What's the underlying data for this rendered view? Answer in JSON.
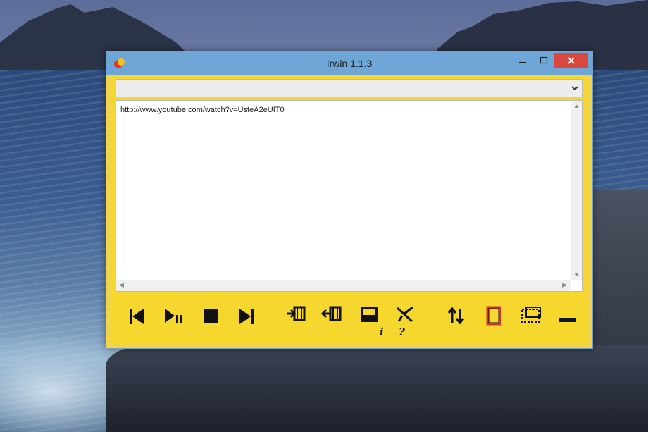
{
  "window": {
    "title": "Irwin 1.1.3",
    "controls": {
      "minimize_icon": "minimize-icon",
      "maximize_icon": "maximize-icon",
      "close_icon": "close-icon"
    }
  },
  "url_dropdown": {
    "selected": ""
  },
  "url_text": "http://www.youtube.com/watch?v=UsteA2eUIT0",
  "toolbar": {
    "info_glyph": "i",
    "help_glyph": "?",
    "icons": [
      "previous-icon",
      "play-pause-icon",
      "stop-icon",
      "next-icon",
      "import-clip-icon",
      "export-clip-icon",
      "save-icon",
      "tools-icon",
      "swap-order-icon",
      "frame-icon",
      "dashed-frame-icon",
      "minimize-bar-icon"
    ]
  },
  "colors": {
    "titlebar": "#6fa6d8",
    "client_bg": "#f5d72e",
    "close_button": "#d9473e",
    "accent_red": "#d9322a"
  }
}
